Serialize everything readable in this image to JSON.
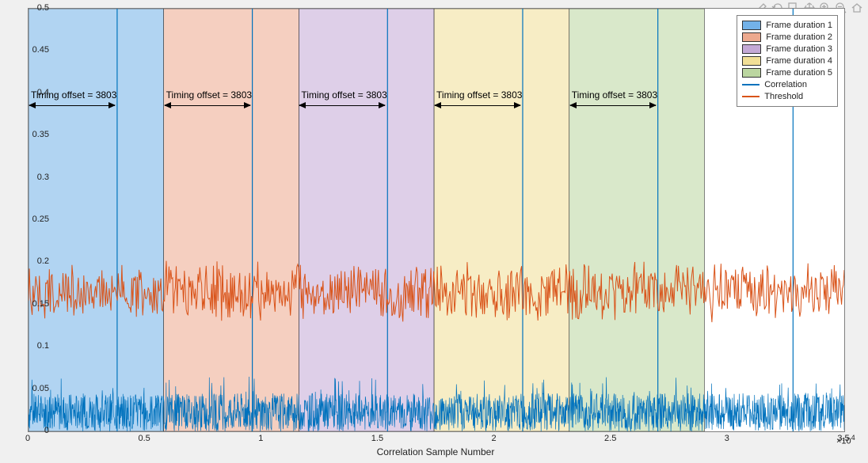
{
  "chart_data": {
    "type": "line",
    "title": "",
    "xlabel": "Correlation Sample Number",
    "ylabel": "",
    "xlim": [
      0,
      35000
    ],
    "ylim": [
      0,
      0.5
    ],
    "x_axis_multiplier": "×10^4",
    "xticks": [
      0,
      5000,
      10000,
      15000,
      20000,
      25000,
      30000,
      35000
    ],
    "xtick_labels": [
      "0",
      "0.5",
      "1",
      "1.5",
      "2",
      "2.5",
      "3",
      "3.5"
    ],
    "yticks": [
      0,
      0.05,
      0.1,
      0.15,
      0.2,
      0.25,
      0.3,
      0.35,
      0.4,
      0.45,
      0.5
    ],
    "series": [
      {
        "name": "Correlation",
        "type": "line",
        "color": "#0072BD",
        "description": "dense noise ~0–0.05 with spikes to 0.5 at x ≈ 3803, 9603, 15403, 21203, 27003, 32803"
      },
      {
        "name": "Threshold",
        "type": "line",
        "color": "#D95319",
        "description": "noisy line fluctuating ~0.14–0.20 across full range"
      }
    ],
    "frame_regions": [
      {
        "label": "Frame duration 1",
        "x0": 0,
        "x1": 5800,
        "color": "rgba(100,170,230,0.5)"
      },
      {
        "label": "Frame duration 2",
        "x0": 5800,
        "x1": 11600,
        "color": "rgba(235,160,130,0.5)"
      },
      {
        "label": "Frame duration 3",
        "x0": 11600,
        "x1": 17400,
        "color": "rgba(190,160,210,0.5)"
      },
      {
        "label": "Frame duration 4",
        "x0": 17400,
        "x1": 23200,
        "color": "rgba(240,220,140,0.5)"
      },
      {
        "label": "Frame duration 5",
        "x0": 23200,
        "x1": 29000,
        "color": "rgba(180,210,150,0.5)"
      }
    ],
    "annotations": [
      {
        "text": "Timing offset = 3803",
        "x0": 0,
        "x1": 3803,
        "y": 0.39
      },
      {
        "text": "Timing offset = 3803",
        "x0": 5800,
        "x1": 9603,
        "y": 0.39
      },
      {
        "text": "Timing offset = 3803",
        "x0": 11600,
        "x1": 15403,
        "y": 0.39
      },
      {
        "text": "Timing offset = 3803",
        "x0": 17400,
        "x1": 21203,
        "y": 0.39
      },
      {
        "text": "Timing offset = 3803",
        "x0": 23200,
        "x1": 27003,
        "y": 0.39
      }
    ]
  },
  "legend": {
    "items": [
      {
        "label": "Frame duration 1",
        "swatch": "rgba(100,170,230,0.9)"
      },
      {
        "label": "Frame duration 2",
        "swatch": "rgba(235,160,130,0.9)"
      },
      {
        "label": "Frame duration 3",
        "swatch": "rgba(190,160,210,0.9)"
      },
      {
        "label": "Frame duration 4",
        "swatch": "rgba(240,220,140,0.9)"
      },
      {
        "label": "Frame duration 5",
        "swatch": "rgba(180,210,150,0.9)"
      },
      {
        "label": "Correlation",
        "line": "#0072BD"
      },
      {
        "label": "Threshold",
        "line": "#D95319"
      }
    ]
  },
  "toolbar_icons": [
    "brush-icon",
    "rotate-icon",
    "datatip-icon",
    "pan-icon",
    "zoom-in-icon",
    "zoom-out-icon",
    "home-icon"
  ]
}
